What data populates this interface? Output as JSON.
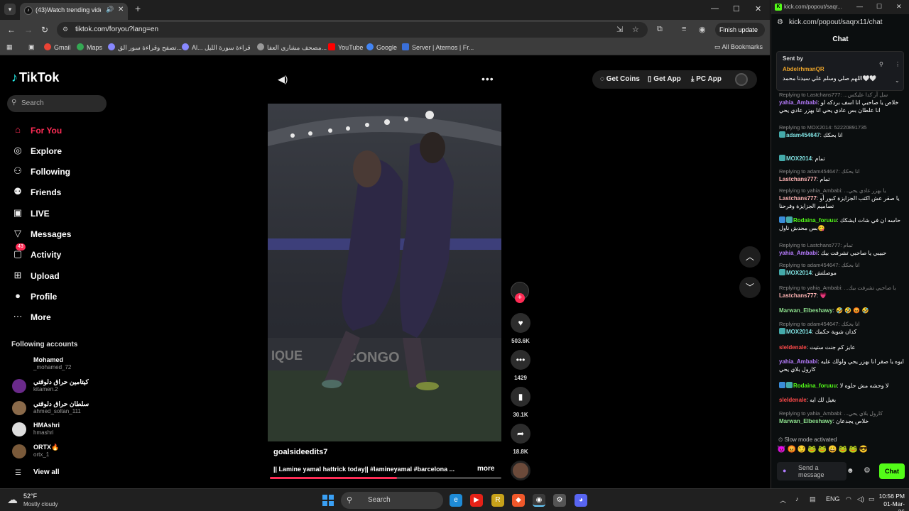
{
  "browser": {
    "tab_title": "(43)Watch trending videos",
    "url": "tiktok.com/foryou?lang=en",
    "finish_update": "Finish update",
    "bookmarks": [
      {
        "label": "Gmail",
        "color": "#ea4335"
      },
      {
        "label": "Maps",
        "color": "#34a853"
      },
      {
        "label": "تصفح وقراءة سور الق...",
        "color": "#8888ff"
      },
      {
        "label": "Al... قراءة سورة الليل",
        "color": "#8888ff"
      },
      {
        "label": "مصحف مشاري العفا...",
        "color": "#999999"
      },
      {
        "label": "YouTube",
        "color": "#ff0000"
      },
      {
        "label": "Google",
        "color": "#4285f4"
      },
      {
        "label": "Server | Aternos | Fr...",
        "color": "#3a6fd8"
      }
    ],
    "all_bookmarks": "All Bookmarks"
  },
  "tiktok": {
    "logo": "TikTok",
    "search_placeholder": "Search",
    "nav": [
      {
        "label": "For You",
        "icon": "home-icon",
        "active": true
      },
      {
        "label": "Explore",
        "icon": "compass-icon"
      },
      {
        "label": "Following",
        "icon": "following-icon"
      },
      {
        "label": "Friends",
        "icon": "friends-icon"
      },
      {
        "label": "LIVE",
        "icon": "live-icon"
      },
      {
        "label": "Messages",
        "icon": "messages-icon"
      },
      {
        "label": "Activity",
        "icon": "activity-icon",
        "badge": "43"
      },
      {
        "label": "Upload",
        "icon": "upload-icon"
      },
      {
        "label": "Profile",
        "icon": "profile-icon"
      },
      {
        "label": "More",
        "icon": "more-icon"
      }
    ],
    "following_title": "Following accounts",
    "accounts": [
      {
        "name": "Mohamed",
        "handle": "_mohamed_72"
      },
      {
        "name": "كيتامين حراق دلوقتي",
        "handle": "kitamen.2"
      },
      {
        "name": "سلطان حراق دلوقتي",
        "handle": "ahmed_soltan_111"
      },
      {
        "name": "HMAshri",
        "handle": "hmashri"
      },
      {
        "name": "ORTX🔥",
        "handle": "ortx_1"
      }
    ],
    "view_all": "View all",
    "top_actions": {
      "coins": "Get Coins",
      "app": "Get App",
      "pc": "PC App"
    },
    "video": {
      "username": "goalsideedits7",
      "caption": "|| Lamine yamal hattrick today|| #lamineyamal #barcelona ...",
      "more": "more",
      "progress": 0.55,
      "likes": "503.6K",
      "comments": "1429",
      "saves": "30.1K",
      "shares": "18.8K"
    }
  },
  "kick": {
    "window_title": "kick.com/popout/saqr...",
    "url": "kick.com/popout/saqrx11/chat",
    "chat_header": "Chat",
    "pinned": {
      "sent_by": "Sent by",
      "user": "AbdelrhmanQR",
      "message": "اللهم صلي وسلم علي سيدنا محمد🤍🤍"
    },
    "messages": [
      {
        "reply": "Replying to Lastchans777: ...سل آر كدا عليكس",
        "user": "yahia_Ambabi",
        "color": "#b77cff",
        "text": "خلاص يا صاحبي انا اسف بردكه لو انا علطان بس عادي يحي انا بهزر عادي يحي"
      },
      {
        "reply": "Replying to MOX2014: 52220891735",
        "user": "adam454647",
        "color": "#7fe0e0",
        "text": "انا بحكك"
      },
      {
        "reply": "",
        "user": "MOX2014",
        "color": "#7fe0e0",
        "text": "تمام"
      },
      {
        "reply": "Replying to adam454647: انا بحكك",
        "user": "Lastchans777",
        "color": "#ffb4b4",
        "text": "تمام"
      },
      {
        "reply": "Replying to yahia_Ambabi: ...يا بهزر عادي يحي",
        "user": "Lastchans777",
        "color": "#ffb4b4",
        "text": "يا صقر عش اكتب الجزايزة كبور أو تصاميم الجزايزة وفرحنا"
      },
      {
        "reply": "",
        "user": "Rodaina_foruuu",
        "color": "#53fc18",
        "text": "حاسه ان في شات ايشكك بس محدش ناول😋"
      },
      {
        "reply": "Replying to Lastchans777: تمام",
        "user": "yahia_Ambabi",
        "color": "#b77cff",
        "text": "حبيبي يا صاحبي تشرفت بيك"
      },
      {
        "reply": "Replying to adam454647: انا بحكك",
        "user": "MOX2014",
        "color": "#7fe0e0",
        "text": "موصلتش"
      },
      {
        "reply": "Replying to yahia_Ambabi: ...يا صاحبي تشرفت بيك",
        "user": "Lastchans777",
        "color": "#ffb4b4",
        "text": "💗"
      },
      {
        "reply": "",
        "user": "Marwan_Elbeshawy",
        "color": "#8de08d",
        "text": "🤣 🤣 😡 🤣"
      },
      {
        "reply": "Replying to adam454647: انا بحكك",
        "user": "MOX2014",
        "color": "#7fe0e0",
        "text": "كدان شوية حكمك"
      },
      {
        "reply": "",
        "user": "sleldenale",
        "color": "#ff4a4a",
        "text": "عايز كم جنت ستيت"
      },
      {
        "reply": "",
        "user": "yahia_Ambabi",
        "color": "#b77cff",
        "text": "ايوه يا صقر انا بهزر يحي ولولك عليه كارول بلاي يحي"
      },
      {
        "reply": "",
        "user": "Rodaina_foruuu",
        "color": "#53fc18",
        "text": "لا وحشه مش حلوه لا"
      },
      {
        "reply": "",
        "user": "sleldenale",
        "color": "#ff4a4a",
        "text": "بغيل لك ايه"
      },
      {
        "reply": "Replying to yahia_Ambabi: ...كارول بلاي يحي",
        "user": "Marwan_Elbeshawy",
        "color": "#8de08d",
        "text": "خلاص يجدعان"
      }
    ],
    "slow_mode": "Slow mode activated",
    "send_placeholder": "Send a message",
    "chat_button": "Chat"
  },
  "taskbar": {
    "temp": "52°F",
    "condition": "Mostly cloudy",
    "search_placeholder": "Search",
    "lang": "ENG",
    "time": "10:56 PM",
    "date": "01-Mar-26"
  }
}
